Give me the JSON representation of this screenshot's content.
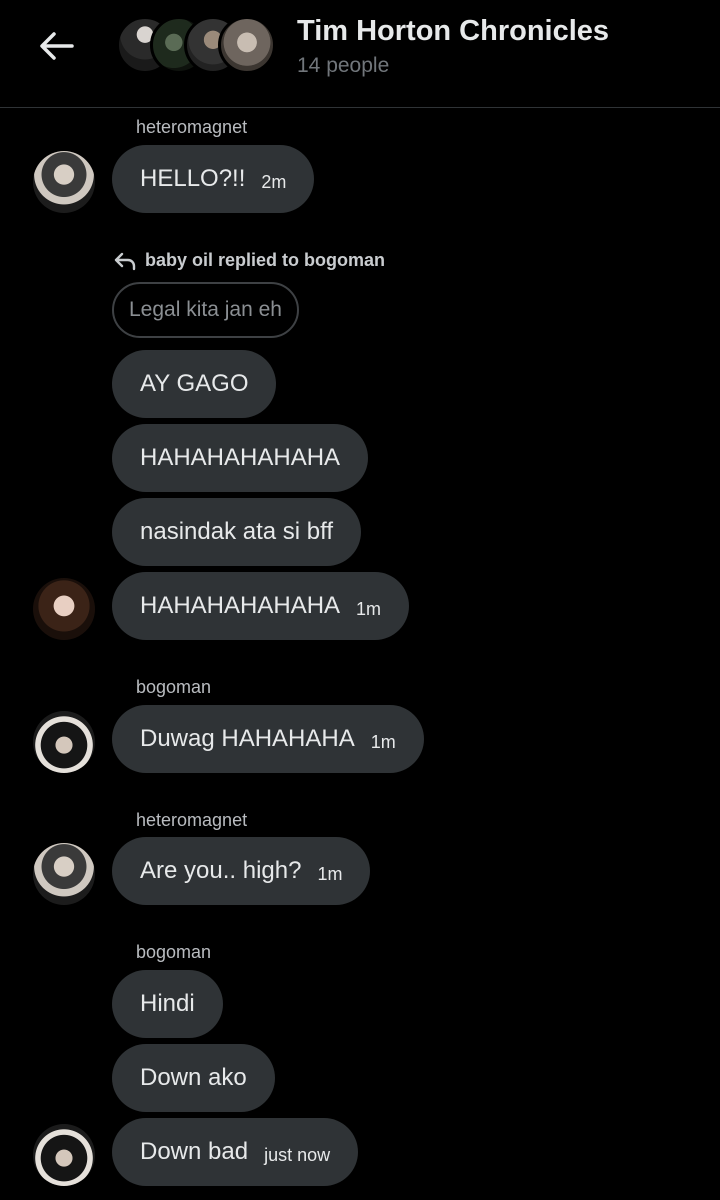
{
  "header": {
    "title": "Tim Horton Chronicles",
    "subtitle": "14 people",
    "back_icon": "arrow-left-icon"
  },
  "messages": [
    {
      "sender": "heteromagnet",
      "text": "HELLO?!!",
      "time": "2m"
    },
    {
      "reply_note": "baby oil replied to bogoman",
      "quoted": "Legal kita jan eh",
      "text": "AY GAGO"
    },
    {
      "text": "HAHAHAHAHAHA"
    },
    {
      "text": "nasindak ata si bff"
    },
    {
      "text": "HAHAHAHAHAHA",
      "time": "1m"
    },
    {
      "sender": "bogoman",
      "text": "Duwag HAHAHAHA",
      "time": "1m"
    },
    {
      "sender": "heteromagnet",
      "text": "Are you.. high?",
      "time": "1m"
    },
    {
      "sender": "bogoman",
      "text": "Hindi"
    },
    {
      "text": "Down ako"
    },
    {
      "text": "Down bad",
      "time": "just now"
    }
  ],
  "colors": {
    "background": "#000000",
    "bubble": "#2f3336",
    "text": "#e7e9ea",
    "muted": "#71767b"
  }
}
